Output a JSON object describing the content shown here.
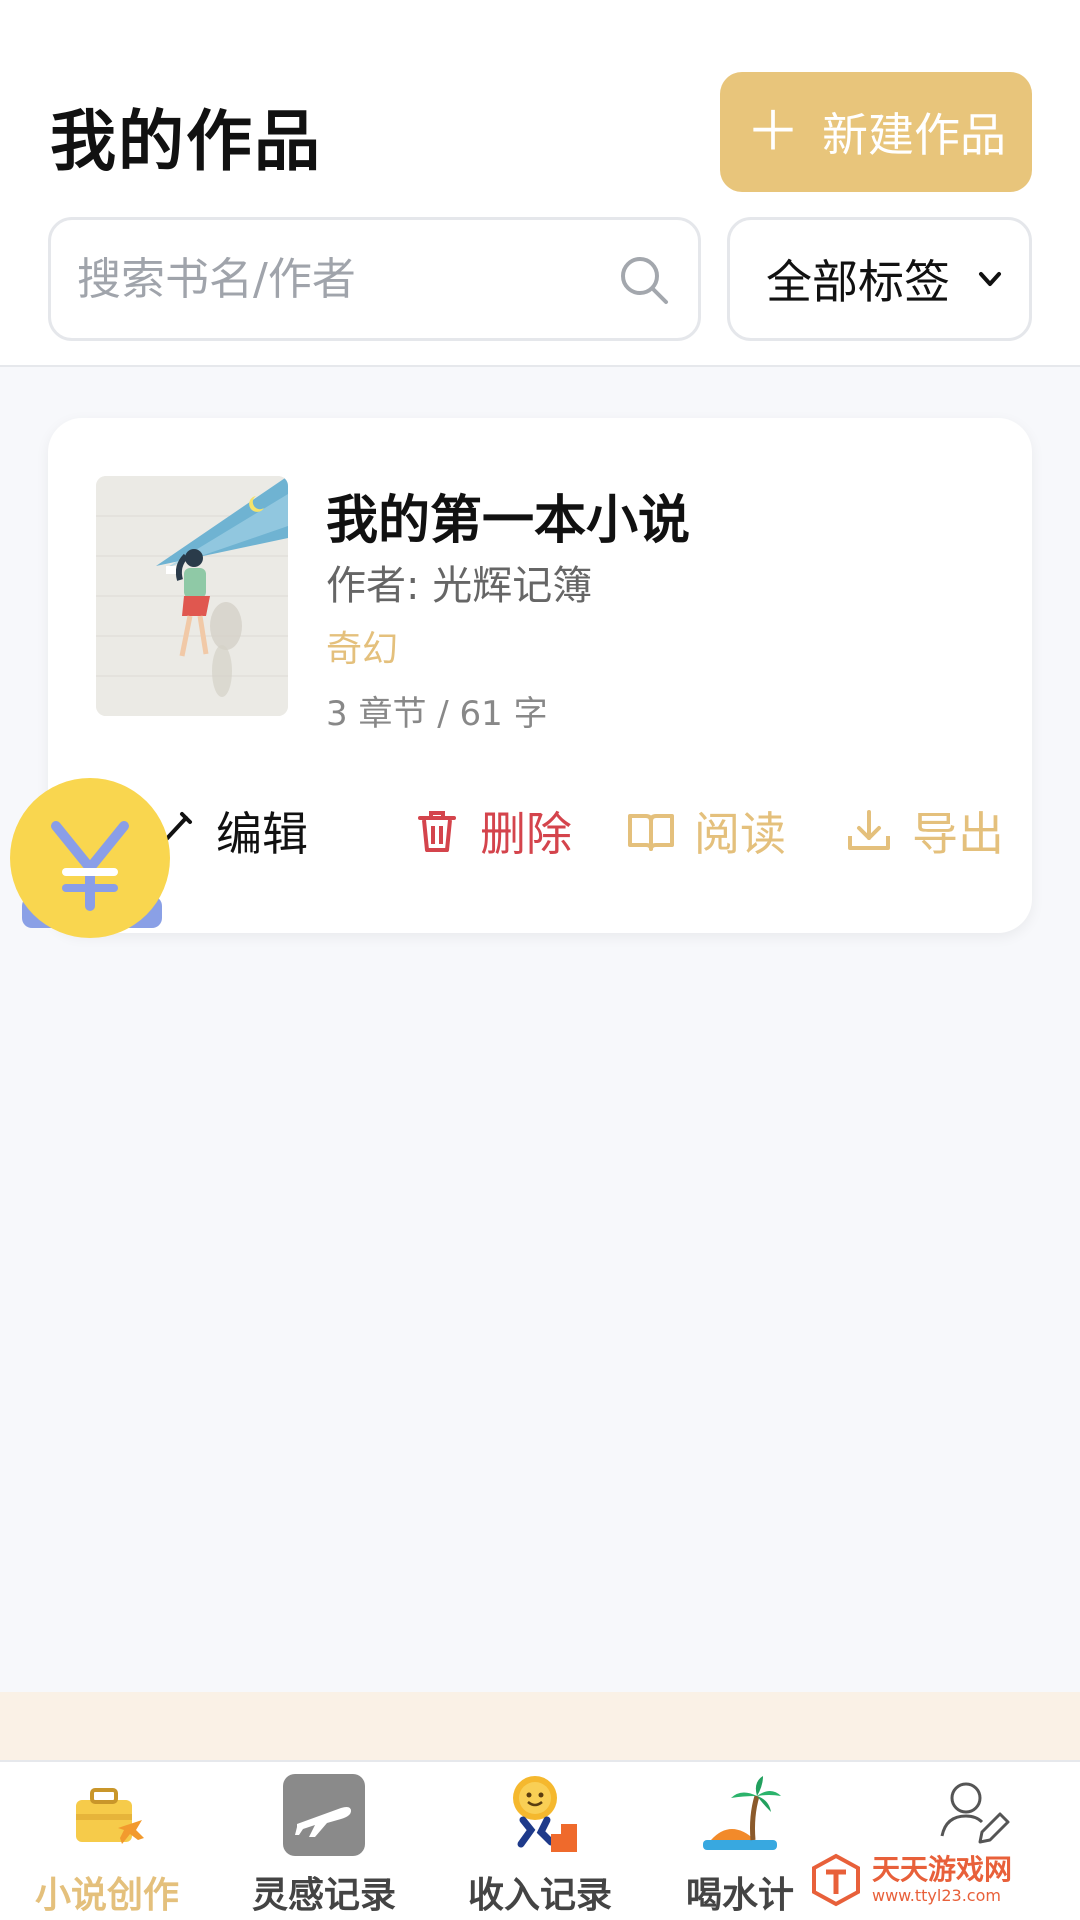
{
  "header": {
    "title": "我的作品",
    "new_button_label": "新建作品"
  },
  "search": {
    "placeholder": "搜索书名/作者",
    "value": ""
  },
  "filter": {
    "selected": "全部标签"
  },
  "works": [
    {
      "title": "我的第一本小说",
      "author": "作者: 光辉记簿",
      "tag": "奇幻",
      "stats": "3 章节 / 61 字",
      "actions": {
        "edit": "编辑",
        "delete": "删除",
        "read": "阅读",
        "export": "导出"
      }
    }
  ],
  "floating_button": {
    "icon": "yen-icon"
  },
  "tabbar": {
    "tabs": [
      {
        "label": "小说创作",
        "icon": "briefcase-plane-icon",
        "active": true
      },
      {
        "label": "灵感记录",
        "icon": "airplane-icon",
        "active": false
      },
      {
        "label": "收入记录",
        "icon": "coin-runner-icon",
        "active": false
      },
      {
        "label": "喝水计",
        "icon": "island-palm-icon",
        "active": false
      },
      {
        "label": "",
        "icon": "user-edit-icon",
        "active": false
      }
    ]
  },
  "watermark": {
    "name": "天天游戏网",
    "url": "www.ttyl23.com"
  },
  "colors": {
    "accent": "#e8c57b",
    "delete": "#d4444c",
    "tag": "#e4c07c",
    "fab": "#f9d64f"
  }
}
